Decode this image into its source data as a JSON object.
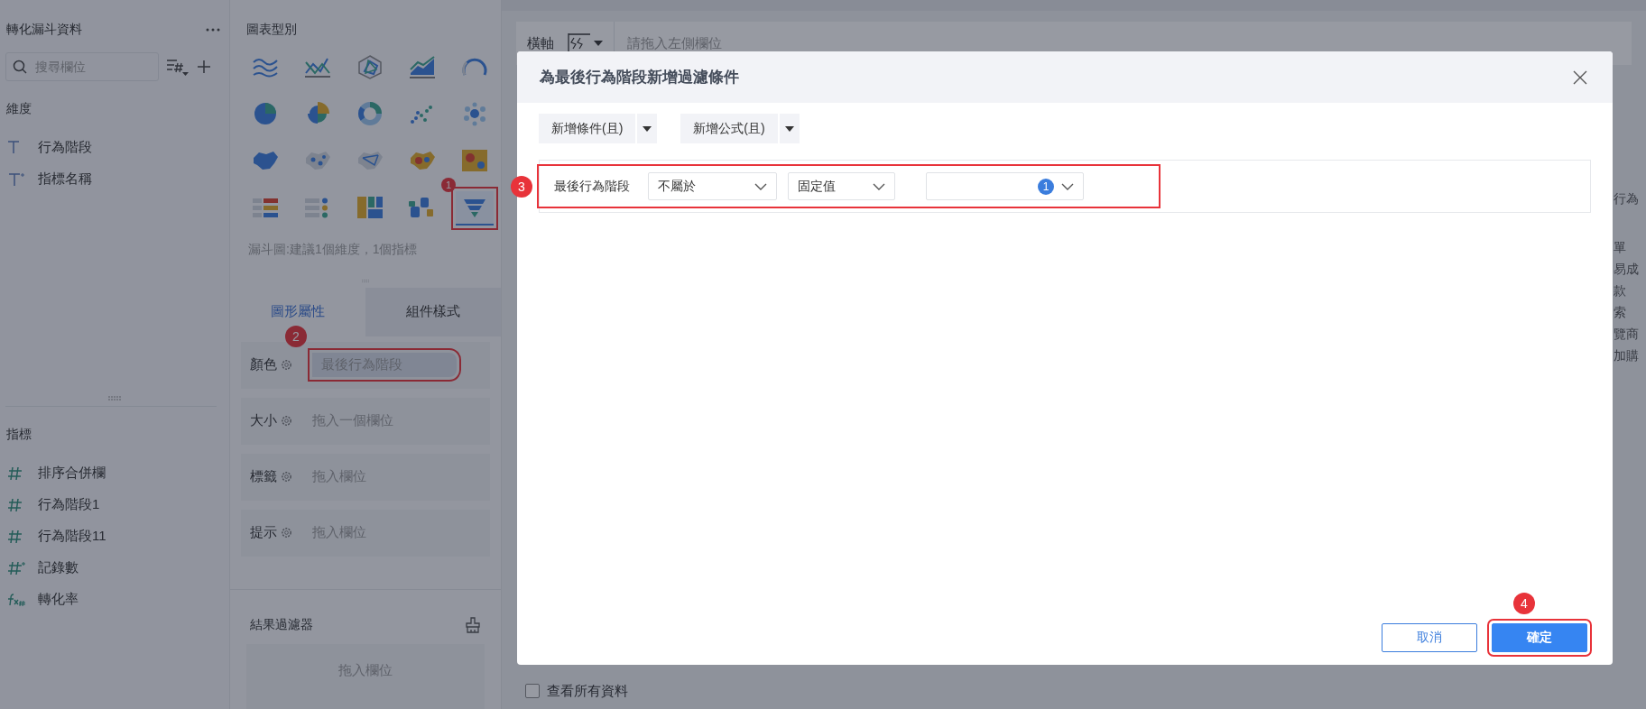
{
  "data_panel": {
    "title": "轉化漏斗資料",
    "search": {
      "placeholder": "搜尋欄位"
    },
    "dimensions": {
      "title": "維度",
      "items": [
        {
          "label": "行為階段",
          "kind": "text"
        },
        {
          "label": "指標名稱",
          "kind": "text-derived"
        }
      ]
    },
    "measures": {
      "title": "指標",
      "items": [
        {
          "label": "排序合併欄",
          "kind": "number"
        },
        {
          "label": "行為階段1",
          "kind": "number"
        },
        {
          "label": "行為階段11",
          "kind": "number"
        },
        {
          "label": "記錄數",
          "kind": "number-derived"
        },
        {
          "label": "轉化率",
          "kind": "formula"
        }
      ]
    }
  },
  "chart_panel": {
    "title": "圖表型別",
    "chart_types": [
      {
        "kind": "multi-line",
        "selected": false
      },
      {
        "kind": "line-cross",
        "selected": false
      },
      {
        "kind": "radar",
        "selected": false
      },
      {
        "kind": "area",
        "selected": false
      },
      {
        "kind": "gauge",
        "selected": false
      },
      {
        "kind": "pie",
        "selected": false
      },
      {
        "kind": "rose",
        "selected": false
      },
      {
        "kind": "donut",
        "selected": false
      },
      {
        "kind": "scatter",
        "selected": false
      },
      {
        "kind": "bubble",
        "selected": false
      },
      {
        "kind": "map-fill",
        "selected": false
      },
      {
        "kind": "map-point",
        "selected": false
      },
      {
        "kind": "map-flow",
        "selected": false
      },
      {
        "kind": "map-heat",
        "selected": false
      },
      {
        "kind": "heatmap",
        "selected": false
      },
      {
        "kind": "kpi-table",
        "selected": false
      },
      {
        "kind": "list-dots",
        "selected": false
      },
      {
        "kind": "treemap",
        "selected": false
      },
      {
        "kind": "word-cloud",
        "selected": false
      },
      {
        "kind": "funnel",
        "selected": true,
        "callout": "1"
      }
    ],
    "hint": "漏斗圖:建議1個維度，1個指標",
    "tabs": [
      {
        "label": "圖形屬性",
        "selected": true
      },
      {
        "label": "組件樣式",
        "selected": false
      }
    ],
    "properties": [
      {
        "label": "顏色",
        "value": "最後行為階段",
        "callout": "2"
      },
      {
        "label": "大小",
        "placeholder": "拖入一個欄位"
      },
      {
        "label": "標籤",
        "placeholder": "拖入欄位"
      },
      {
        "label": "提示",
        "placeholder": "拖入欄位"
      }
    ],
    "result_filter": {
      "title": "結果過濾器",
      "placeholder": "拖入欄位"
    }
  },
  "editor": {
    "axis_label": "橫軸",
    "axis_placeholder": "請拖入左側欄位",
    "background_texts": [
      "行為",
      "單",
      "易成",
      "款",
      "索",
      "覽商",
      "加購"
    ],
    "view_all": {
      "label": "查看所有資料",
      "checked": false
    }
  },
  "dialog": {
    "title": "為最後行為階段新增過濾條件",
    "add_buttons": [
      {
        "label": "新增條件(且)"
      },
      {
        "label": "新增公式(且)"
      }
    ],
    "condition": {
      "field": "最後行為階段",
      "operator": "不屬於",
      "value_type": "固定值",
      "selected_count": "1",
      "callout": "3"
    },
    "buttons": [
      {
        "label": "取消",
        "kind": "secondary"
      },
      {
        "label": "確定",
        "kind": "primary",
        "callout": "4"
      }
    ]
  }
}
